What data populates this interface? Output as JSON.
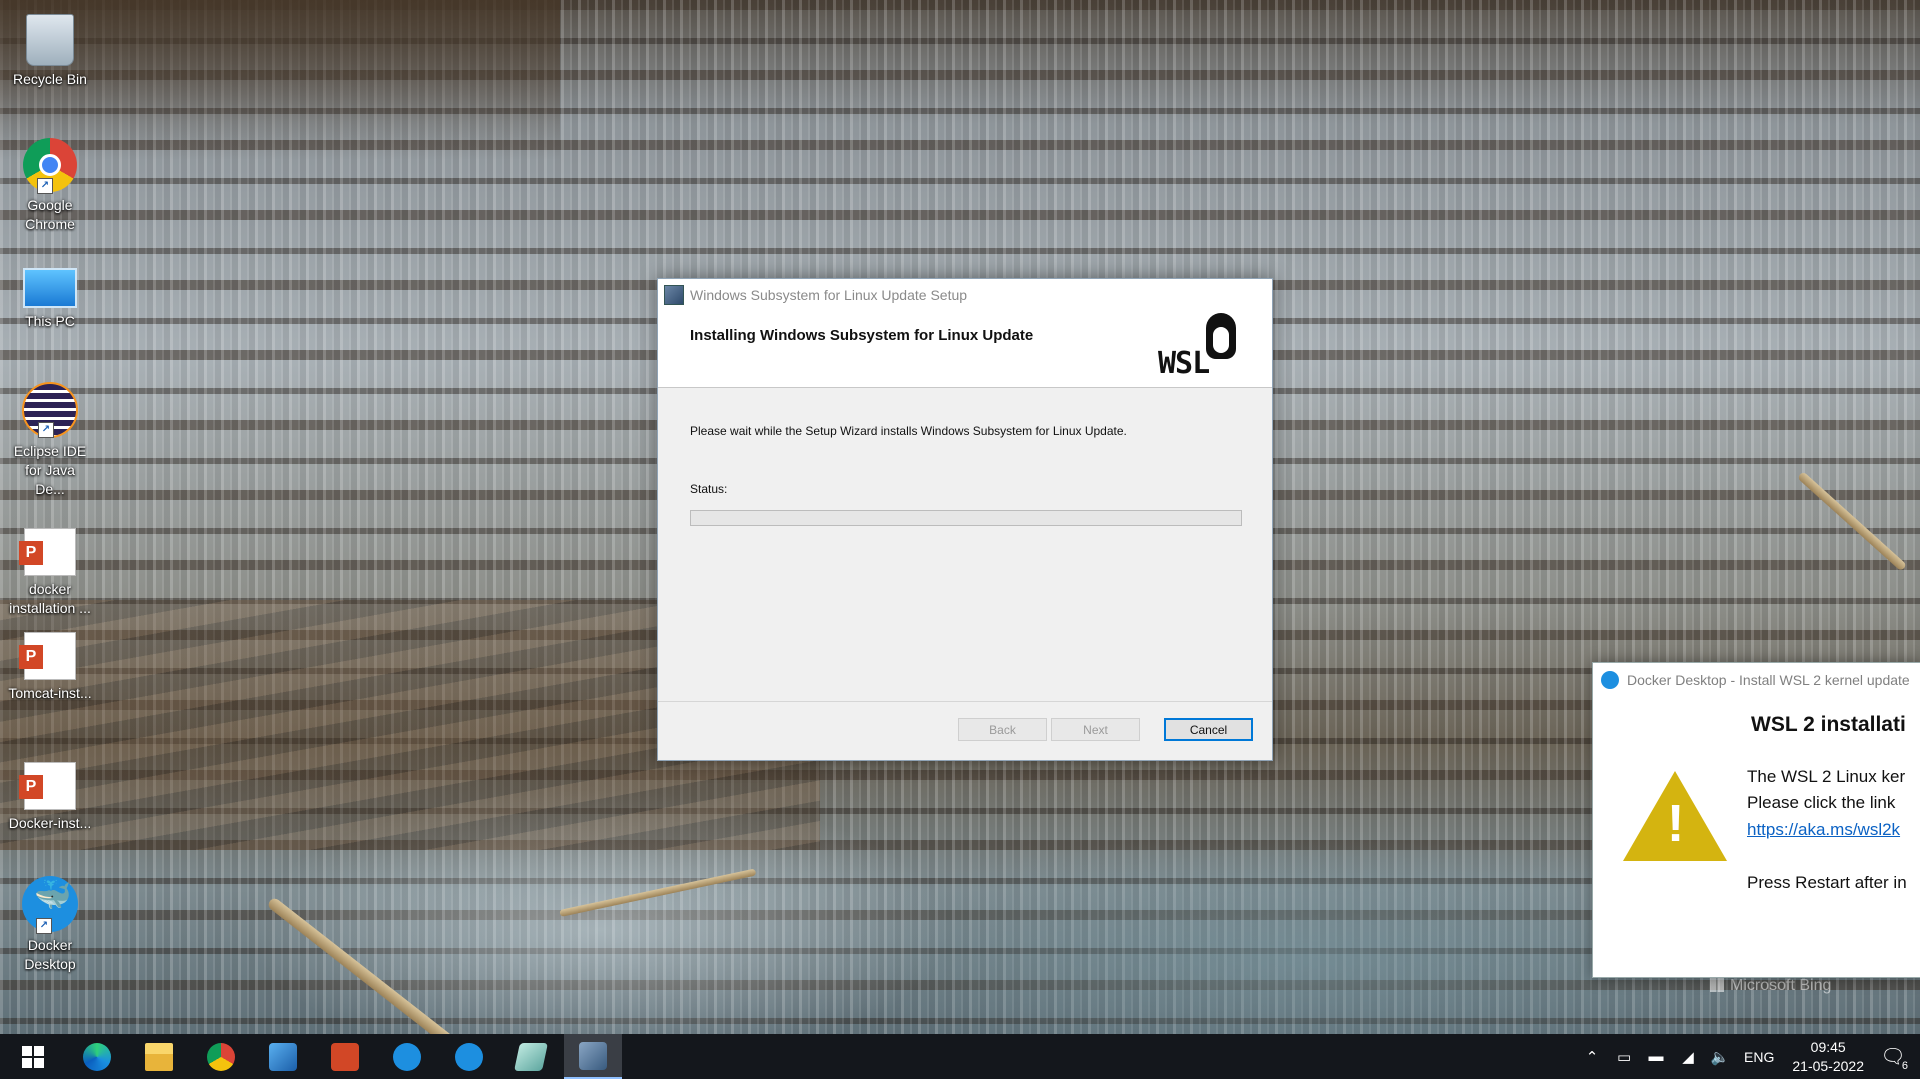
{
  "desktop": {
    "icons": [
      {
        "label": "Recycle Bin"
      },
      {
        "label": "Google Chrome"
      },
      {
        "label": "This PC"
      },
      {
        "label": "Eclipse IDE for Java De..."
      },
      {
        "label": "docker installation ..."
      },
      {
        "label": "Tomcat-inst..."
      },
      {
        "label": "Docker-inst..."
      },
      {
        "label": "Docker Desktop"
      }
    ],
    "wallpaper_credit": "Microsoft Bing"
  },
  "setup_window": {
    "title": "Windows Subsystem for Linux Update Setup",
    "heading": "Installing Windows Subsystem for Linux Update",
    "logo_text": "WSL",
    "message": "Please wait while the Setup Wizard installs Windows Subsystem for Linux Update.",
    "status_label": "Status:",
    "progress_percent": 0,
    "buttons": {
      "back": "Back",
      "next": "Next",
      "cancel": "Cancel"
    }
  },
  "docker_window": {
    "title": "Docker Desktop - Install WSL 2 kernel update",
    "heading": "WSL 2 installati",
    "line1": "The WSL 2 Linux ker",
    "line2": "Please click the link",
    "link": "https://aka.ms/wsl2k",
    "line3": "Press Restart after in"
  },
  "taskbar": {
    "tray": {
      "language": "ENG",
      "time": "09:45",
      "date": "21-05-2022",
      "notification_count": "6"
    }
  },
  "colors": {
    "accent": "#0078d7",
    "warning": "#d4b410",
    "link": "#0b62c4",
    "taskbar": "#14171c"
  }
}
